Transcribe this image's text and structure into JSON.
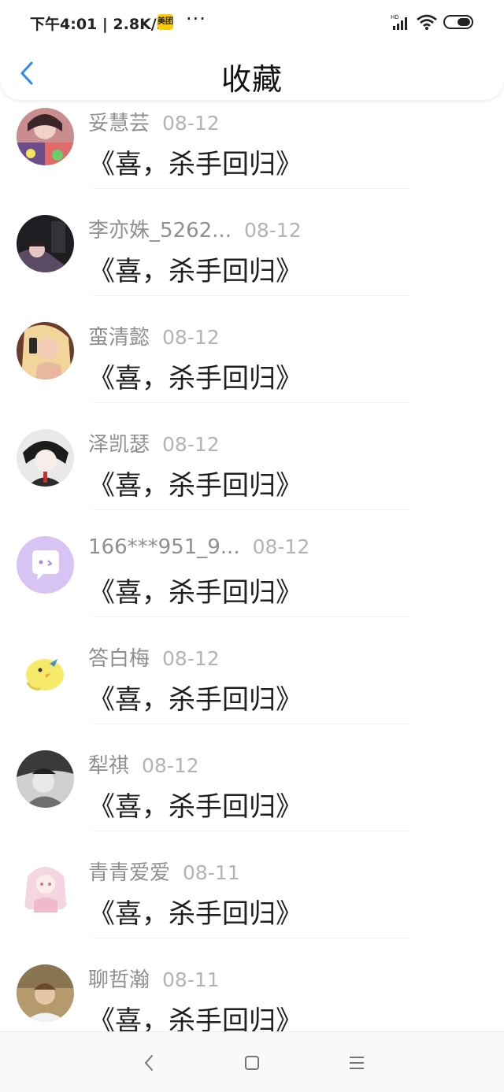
{
  "status_bar": {
    "time": "下午4:01 | 2.8K/s",
    "badge": "美团",
    "more": "···"
  },
  "header": {
    "title": "收藏"
  },
  "items": [
    {
      "name": "妥慧芸",
      "date": "08-12",
      "message": "《喜，杀手回归》"
    },
    {
      "name": "李亦姝_5262...",
      "date": "08-12",
      "message": "《喜，杀手回归》"
    },
    {
      "name": "蛮清懿",
      "date": "08-12",
      "message": "《喜，杀手回归》"
    },
    {
      "name": "泽凯瑟",
      "date": "08-12",
      "message": "《喜，杀手回归》"
    },
    {
      "name": "166***951_9...",
      "date": "08-12",
      "message": "《喜，杀手回归》"
    },
    {
      "name": "答白梅",
      "date": "08-12",
      "message": "《喜，杀手回归》"
    },
    {
      "name": "犁祺",
      "date": "08-12",
      "message": "《喜，杀手回归》"
    },
    {
      "name": "青青爱爱",
      "date": "08-11",
      "message": "《喜，杀手回归》"
    },
    {
      "name": "聊哲瀚",
      "date": "08-11",
      "message": "《喜，杀手回归》"
    }
  ],
  "icons": {
    "back": "chevron-left-icon",
    "nav_back": "nav-back-icon",
    "nav_home": "nav-home-icon",
    "nav_menu": "nav-menu-icon"
  },
  "colors": {
    "accent": "#2a8ce8",
    "name_text": "#8f8f8f",
    "date_text": "#b4b4b4",
    "placeholder_avatar": "#d7c4f5"
  }
}
